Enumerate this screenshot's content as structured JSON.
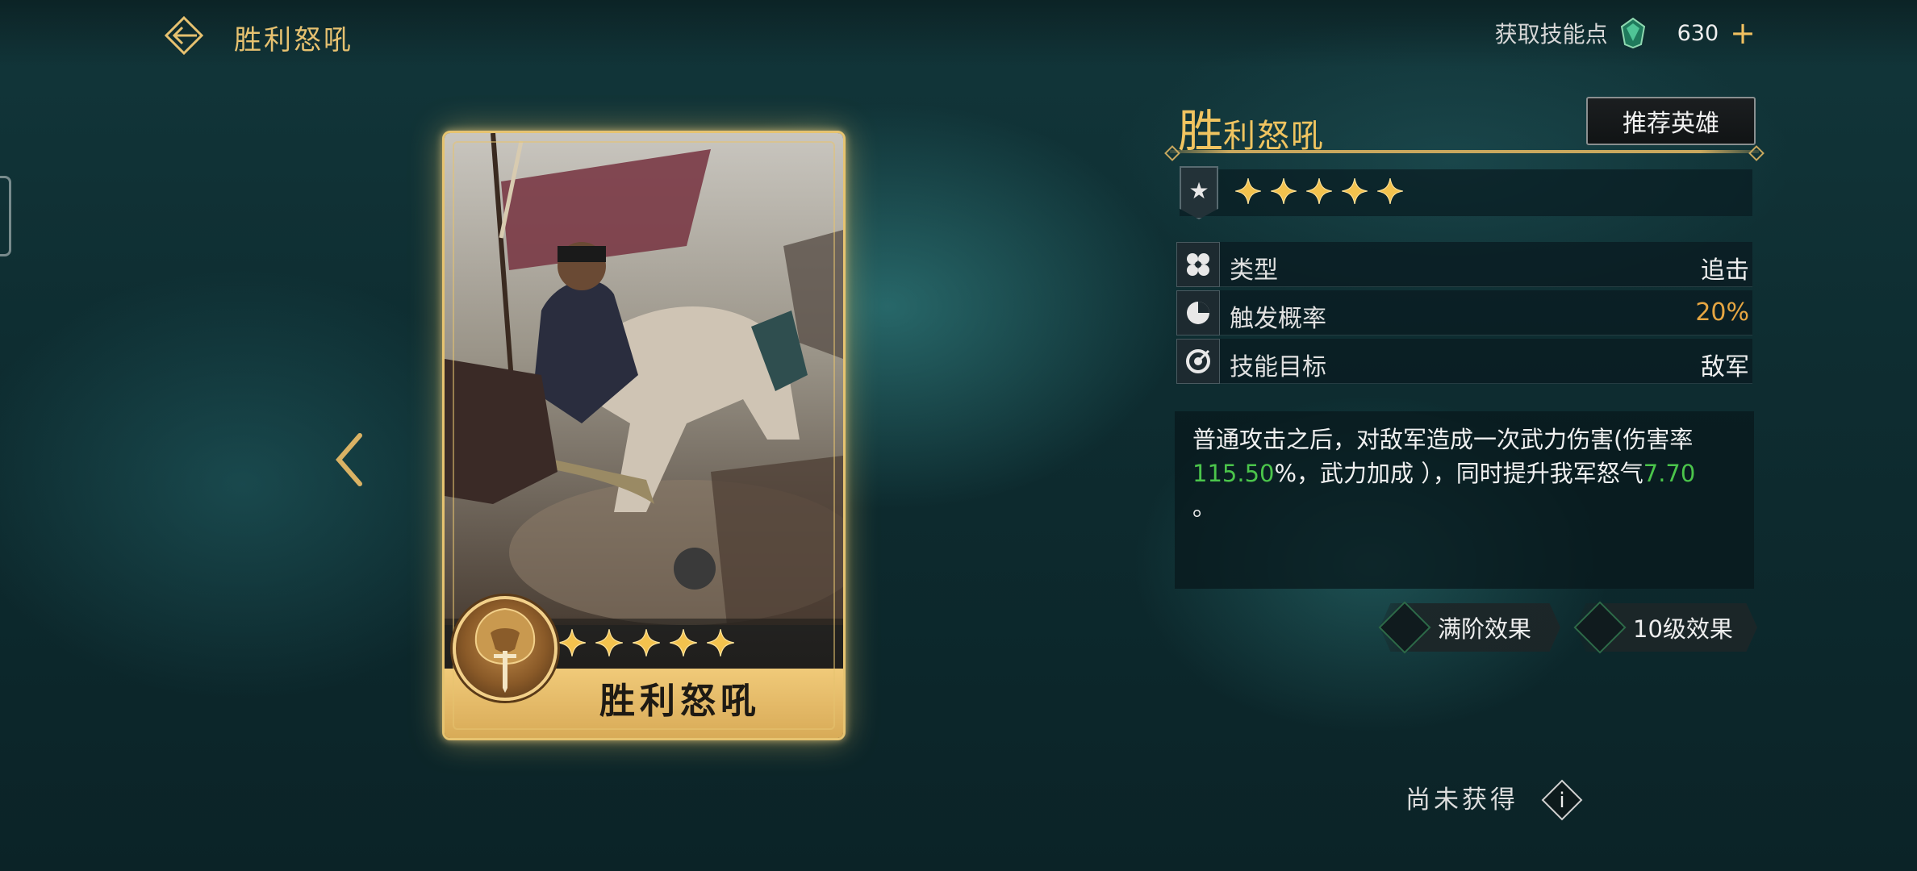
{
  "header": {
    "title": "胜利怒吼",
    "skill_points_label": "获取技能点",
    "skill_points_value": "630",
    "add_symbol": "+"
  },
  "card": {
    "name": "胜利怒吼",
    "stars": 5
  },
  "skill": {
    "title_first": "胜",
    "title_rest": "利怒吼",
    "recommend_label": "推荐英雄",
    "stars": 5,
    "attributes": [
      {
        "label": "类型",
        "value": "追击"
      },
      {
        "label": "触发概率",
        "value": "20%"
      },
      {
        "label": "技能目标",
        "value": "敌军"
      }
    ],
    "description": {
      "part1": "普通攻击之后，对敌军造成一次武力伤害(伤害率",
      "value1": "115.50",
      "part2": "%，武力加成 ），同时提升我军怒气",
      "value2": "7.70",
      "part3": "。"
    },
    "effects": {
      "full_rank": "满阶效果",
      "level10": "10级效果"
    },
    "status": "尚未获得",
    "info_symbol": "i"
  },
  "colors": {
    "gold": "#f0c460",
    "highlight_green": "#4bc54b",
    "probability_orange": "#e6a642"
  }
}
